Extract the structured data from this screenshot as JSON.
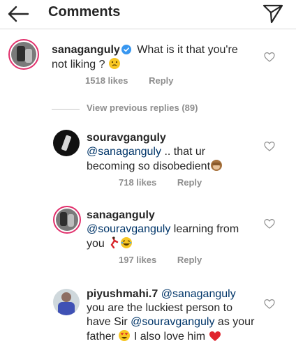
{
  "header": {
    "title": "Comments",
    "back_icon": "arrow-left-icon",
    "send_icon": "paper-plane-icon"
  },
  "colors": {
    "mention": "#003569",
    "meta": "#8e8e8e",
    "story_ring": "#e1306c",
    "heart_red": "#e0242e"
  },
  "comments": [
    {
      "username": "sanaganguly",
      "verified": true,
      "text_part1": "What is it that you're",
      "text_part2": "not liking ?",
      "emoji": "thinking-face-emoji",
      "likes": "1518 likes",
      "reply": "Reply"
    },
    {
      "username": "souravganguly",
      "mention": "@sanaganguly",
      "text_part1": ".. that ur",
      "text_part2": "becoming so disobedient",
      "emoji": "see-no-evil-monkey-emoji",
      "likes": "718 likes",
      "reply": "Reply"
    },
    {
      "username": "sanaganguly",
      "mention": "@souravganguly",
      "text_part1": "learning from",
      "text_part2": "you",
      "emoji": "dancer-laughing-emoji",
      "likes": "197 likes",
      "reply": "Reply"
    },
    {
      "username": "piyushmahi.7",
      "mention": "@sanaganguly",
      "line2": "you are the luckiest person to",
      "line3_pre": "have Sir",
      "line3_mention": "@souravganguly",
      "line3_post": "as your",
      "line4_pre": "father",
      "line4_post": "I also love him",
      "emoji": "heart-eyes-emoji"
    }
  ],
  "view_previous": "View previous replies (89)"
}
